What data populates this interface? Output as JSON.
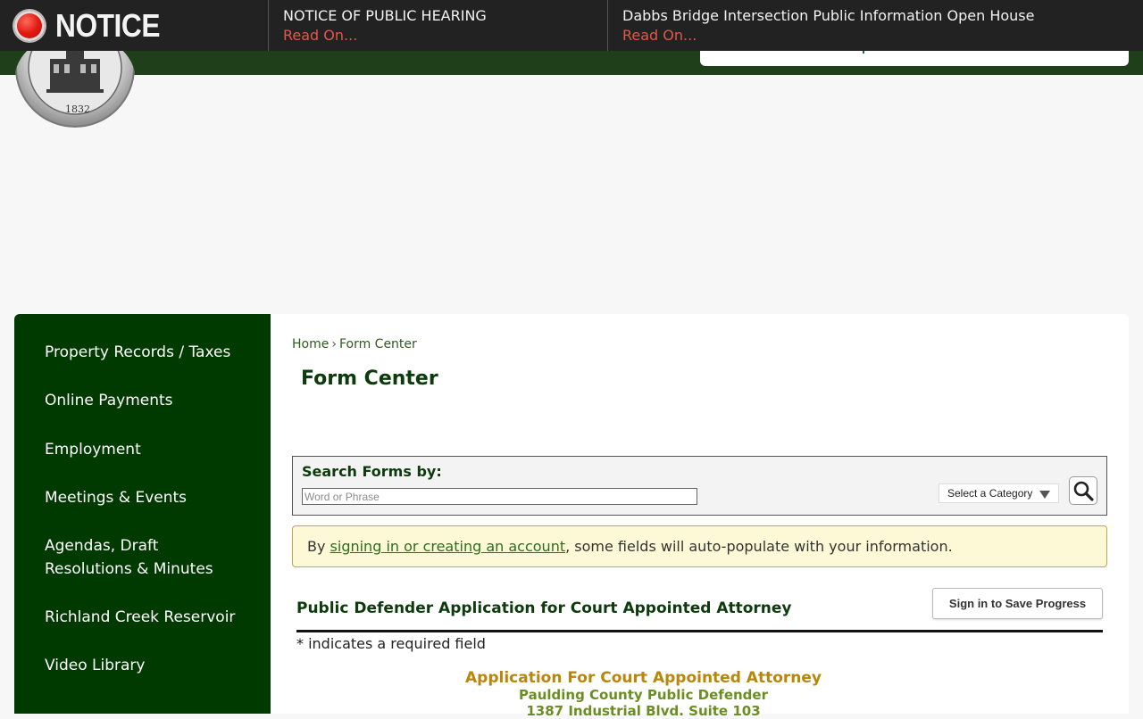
{
  "notice": {
    "label": "NOTICE",
    "items": [
      {
        "title": "NOTICE OF PUBLIC HEARING",
        "link": "Read On..."
      },
      {
        "title": "Dabbs Bridge Intersection Public Information Open House",
        "link": "Read On..."
      }
    ]
  },
  "logo": {
    "year": "1832"
  },
  "sidebar": {
    "items": [
      {
        "label": "Property Records / Taxes"
      },
      {
        "label": "Online Payments"
      },
      {
        "label": "Employment"
      },
      {
        "label": "Meetings & Events"
      },
      {
        "label": "Agendas, Draft Resolutions & Minutes"
      },
      {
        "label": "Richland Creek Reservoir"
      },
      {
        "label": "Video Library"
      }
    ]
  },
  "breadcrumb": {
    "home": "Home",
    "separator": "›",
    "current": "Form Center"
  },
  "page": {
    "title": "Form Center"
  },
  "search": {
    "label": "Search Forms by:",
    "placeholder": "Word or Phrase",
    "category": "Select a Category"
  },
  "signin": {
    "prefix": "By ",
    "link": "signing in or creating an account",
    "suffix": ", some fields will auto-populate with your information."
  },
  "form": {
    "title": "Public Defender Application for Court Appointed Attorney",
    "save_label": "Sign in to Save Progress",
    "required_note": "* indicates a required field",
    "heading": "Application For Court Appointed Attorney",
    "subheading": "Paulding County Public Defender",
    "address": "1387 Industrial Blvd. Suite 103"
  },
  "colors": {
    "notice_bg": "#222222",
    "sidebar_bg": "#003a00",
    "accent_link": "#e0584b",
    "heading_gold": "#b8860b"
  }
}
